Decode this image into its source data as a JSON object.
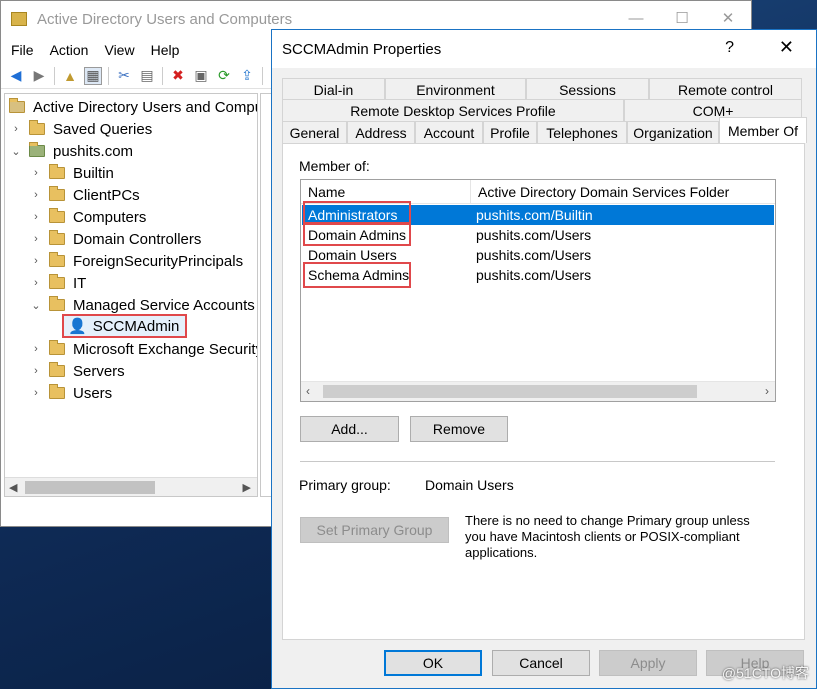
{
  "main_window": {
    "title": "Active Directory Users and Computers",
    "controls": {
      "minimize": "—",
      "maximize": "☐",
      "close": "✕"
    },
    "menu": [
      "File",
      "Action",
      "View",
      "Help"
    ],
    "tree": {
      "root": "Active Directory Users and Compu",
      "saved_queries": "Saved Queries",
      "domain": "pushits.com",
      "ous": [
        "Builtin",
        "ClientPCs",
        "Computers",
        "Domain Controllers",
        "ForeignSecurityPrincipals",
        "IT",
        "Managed Service Accounts"
      ],
      "selected_user": "SCCMAdmin",
      "ous_after": [
        "Microsoft Exchange Security",
        "Servers",
        "Users"
      ]
    }
  },
  "dialog": {
    "title": "SCCMAdmin Properties",
    "help": "?",
    "close": "✕",
    "tabs_row1": [
      "Dial-in",
      "Environment",
      "Sessions",
      "Remote control"
    ],
    "tabs_row2": [
      "Remote Desktop Services Profile",
      "COM+"
    ],
    "tabs_row3": [
      "General",
      "Address",
      "Account",
      "Profile",
      "Telephones",
      "Organization",
      "Member Of"
    ],
    "member_of_label": "Member of:",
    "columns": [
      "Name",
      "Active Directory Domain Services Folder"
    ],
    "rows": [
      {
        "name": "Administrators",
        "folder": "pushits.com/Builtin"
      },
      {
        "name": "Domain Admins",
        "folder": "pushits.com/Users"
      },
      {
        "name": "Domain Users",
        "folder": "pushits.com/Users"
      },
      {
        "name": "Schema Admins",
        "folder": "pushits.com/Users"
      }
    ],
    "add_button": "Add...",
    "remove_button": "Remove",
    "primary_group_label": "Primary group:",
    "primary_group_value": "Domain Users",
    "set_primary_button": "Set Primary Group",
    "note": [
      "There is no need to change Primary group unless",
      "you have Macintosh clients or POSIX-compliant",
      "applications."
    ],
    "ok_button": "OK",
    "cancel_button": "Cancel",
    "apply_button": "Apply",
    "help_button": "Help"
  },
  "watermark": "@51CTO博客",
  "icons": {
    "back": "back-arrow-icon",
    "forward": "forward-arrow-icon",
    "delete": "delete-icon",
    "refresh": "refresh-icon",
    "user": "user-icon",
    "folder": "folder-icon",
    "domain": "domain-icon"
  }
}
